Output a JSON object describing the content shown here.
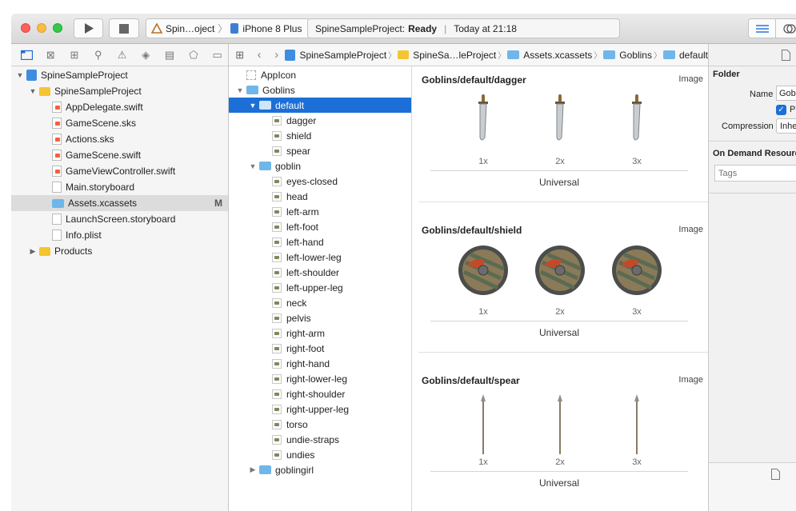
{
  "window": {
    "scheme_target": "Spin…oject",
    "device": "iPhone 8 Plus",
    "status_project": "SpineSampleProject:",
    "status_state": "Ready",
    "status_time": "Today at 21:18"
  },
  "navigator": {
    "items": [
      {
        "label": "SpineSampleProject",
        "icon": "project-icon",
        "depth": 0,
        "open": true
      },
      {
        "label": "SpineSampleProject",
        "icon": "folder-icon",
        "depth": 1,
        "open": true
      },
      {
        "label": "AppDelegate.swift",
        "icon": "swift-file-icon",
        "depth": 2
      },
      {
        "label": "GameScene.sks",
        "icon": "swift-file-icon",
        "depth": 2
      },
      {
        "label": "Actions.sks",
        "icon": "swift-file-icon",
        "depth": 2
      },
      {
        "label": "GameScene.swift",
        "icon": "swift-file-icon",
        "depth": 2
      },
      {
        "label": "GameViewController.swift",
        "icon": "swift-file-icon",
        "depth": 2
      },
      {
        "label": "Main.storyboard",
        "icon": "storyboard-icon",
        "depth": 2
      },
      {
        "label": "Assets.xcassets",
        "icon": "asset-catalog-icon",
        "depth": 2,
        "selected": true,
        "badge": "M"
      },
      {
        "label": "LaunchScreen.storyboard",
        "icon": "storyboard-icon",
        "depth": 2
      },
      {
        "label": "Info.plist",
        "icon": "plist-icon",
        "depth": 2
      },
      {
        "label": "Products",
        "icon": "folder-icon",
        "depth": 1,
        "open": false
      }
    ]
  },
  "jumpbar": {
    "crumbs": [
      "SpineSampleProject",
      "SpineSa…leProject",
      "Assets.xcassets",
      "Goblins",
      "default"
    ]
  },
  "assets": {
    "items": [
      {
        "label": "AppIcon",
        "kind": "appicon",
        "depth": 0
      },
      {
        "label": "Goblins",
        "kind": "folder",
        "depth": 0,
        "open": true
      },
      {
        "label": "default",
        "kind": "folder",
        "depth": 1,
        "open": true,
        "selected": true
      },
      {
        "label": "dagger",
        "kind": "image",
        "depth": 2
      },
      {
        "label": "shield",
        "kind": "image",
        "depth": 2
      },
      {
        "label": "spear",
        "kind": "image",
        "depth": 2
      },
      {
        "label": "goblin",
        "kind": "folder",
        "depth": 1,
        "open": true
      },
      {
        "label": "eyes-closed",
        "kind": "image",
        "depth": 2
      },
      {
        "label": "head",
        "kind": "image",
        "depth": 2
      },
      {
        "label": "left-arm",
        "kind": "image",
        "depth": 2
      },
      {
        "label": "left-foot",
        "kind": "image",
        "depth": 2
      },
      {
        "label": "left-hand",
        "kind": "image",
        "depth": 2
      },
      {
        "label": "left-lower-leg",
        "kind": "image",
        "depth": 2
      },
      {
        "label": "left-shoulder",
        "kind": "image",
        "depth": 2
      },
      {
        "label": "left-upper-leg",
        "kind": "image",
        "depth": 2
      },
      {
        "label": "neck",
        "kind": "image",
        "depth": 2
      },
      {
        "label": "pelvis",
        "kind": "image",
        "depth": 2
      },
      {
        "label": "right-arm",
        "kind": "image",
        "depth": 2
      },
      {
        "label": "right-foot",
        "kind": "image",
        "depth": 2
      },
      {
        "label": "right-hand",
        "kind": "image",
        "depth": 2
      },
      {
        "label": "right-lower-leg",
        "kind": "image",
        "depth": 2
      },
      {
        "label": "right-shoulder",
        "kind": "image",
        "depth": 2
      },
      {
        "label": "right-upper-leg",
        "kind": "image",
        "depth": 2
      },
      {
        "label": "torso",
        "kind": "image",
        "depth": 2
      },
      {
        "label": "undie-straps",
        "kind": "image",
        "depth": 2
      },
      {
        "label": "undies",
        "kind": "image",
        "depth": 2
      },
      {
        "label": "goblingirl",
        "kind": "folder",
        "depth": 1,
        "open": false
      }
    ]
  },
  "detail": {
    "sets": [
      {
        "title": "Goblins/default/dagger",
        "kind": "Image",
        "art": "dagger",
        "scales": [
          "1x",
          "2x",
          "3x"
        ],
        "idiom": "Universal"
      },
      {
        "title": "Goblins/default/shield",
        "kind": "Image",
        "art": "shield",
        "scales": [
          "1x",
          "2x",
          "3x"
        ],
        "idiom": "Universal"
      },
      {
        "title": "Goblins/default/spear",
        "kind": "Image",
        "art": "spear",
        "scales": [
          "1x",
          "2x",
          "3x"
        ],
        "idiom": "Universal"
      }
    ]
  },
  "inspector": {
    "section_title": "Folder",
    "name_label": "Name",
    "name_value": "Gob",
    "checkbox_label": "Pr",
    "compression_label": "Compression",
    "compression_value": "Inhe",
    "on_demand_title": "On Demand Resource",
    "tags_placeholder": "Tags"
  },
  "colors": {
    "selection": "#1c6fd6",
    "folder_yellow": "#f5c431",
    "folder_blue": "#6fb6ea",
    "close": "#fc605b",
    "minimize": "#fdbc40",
    "zoom": "#34c84a"
  }
}
